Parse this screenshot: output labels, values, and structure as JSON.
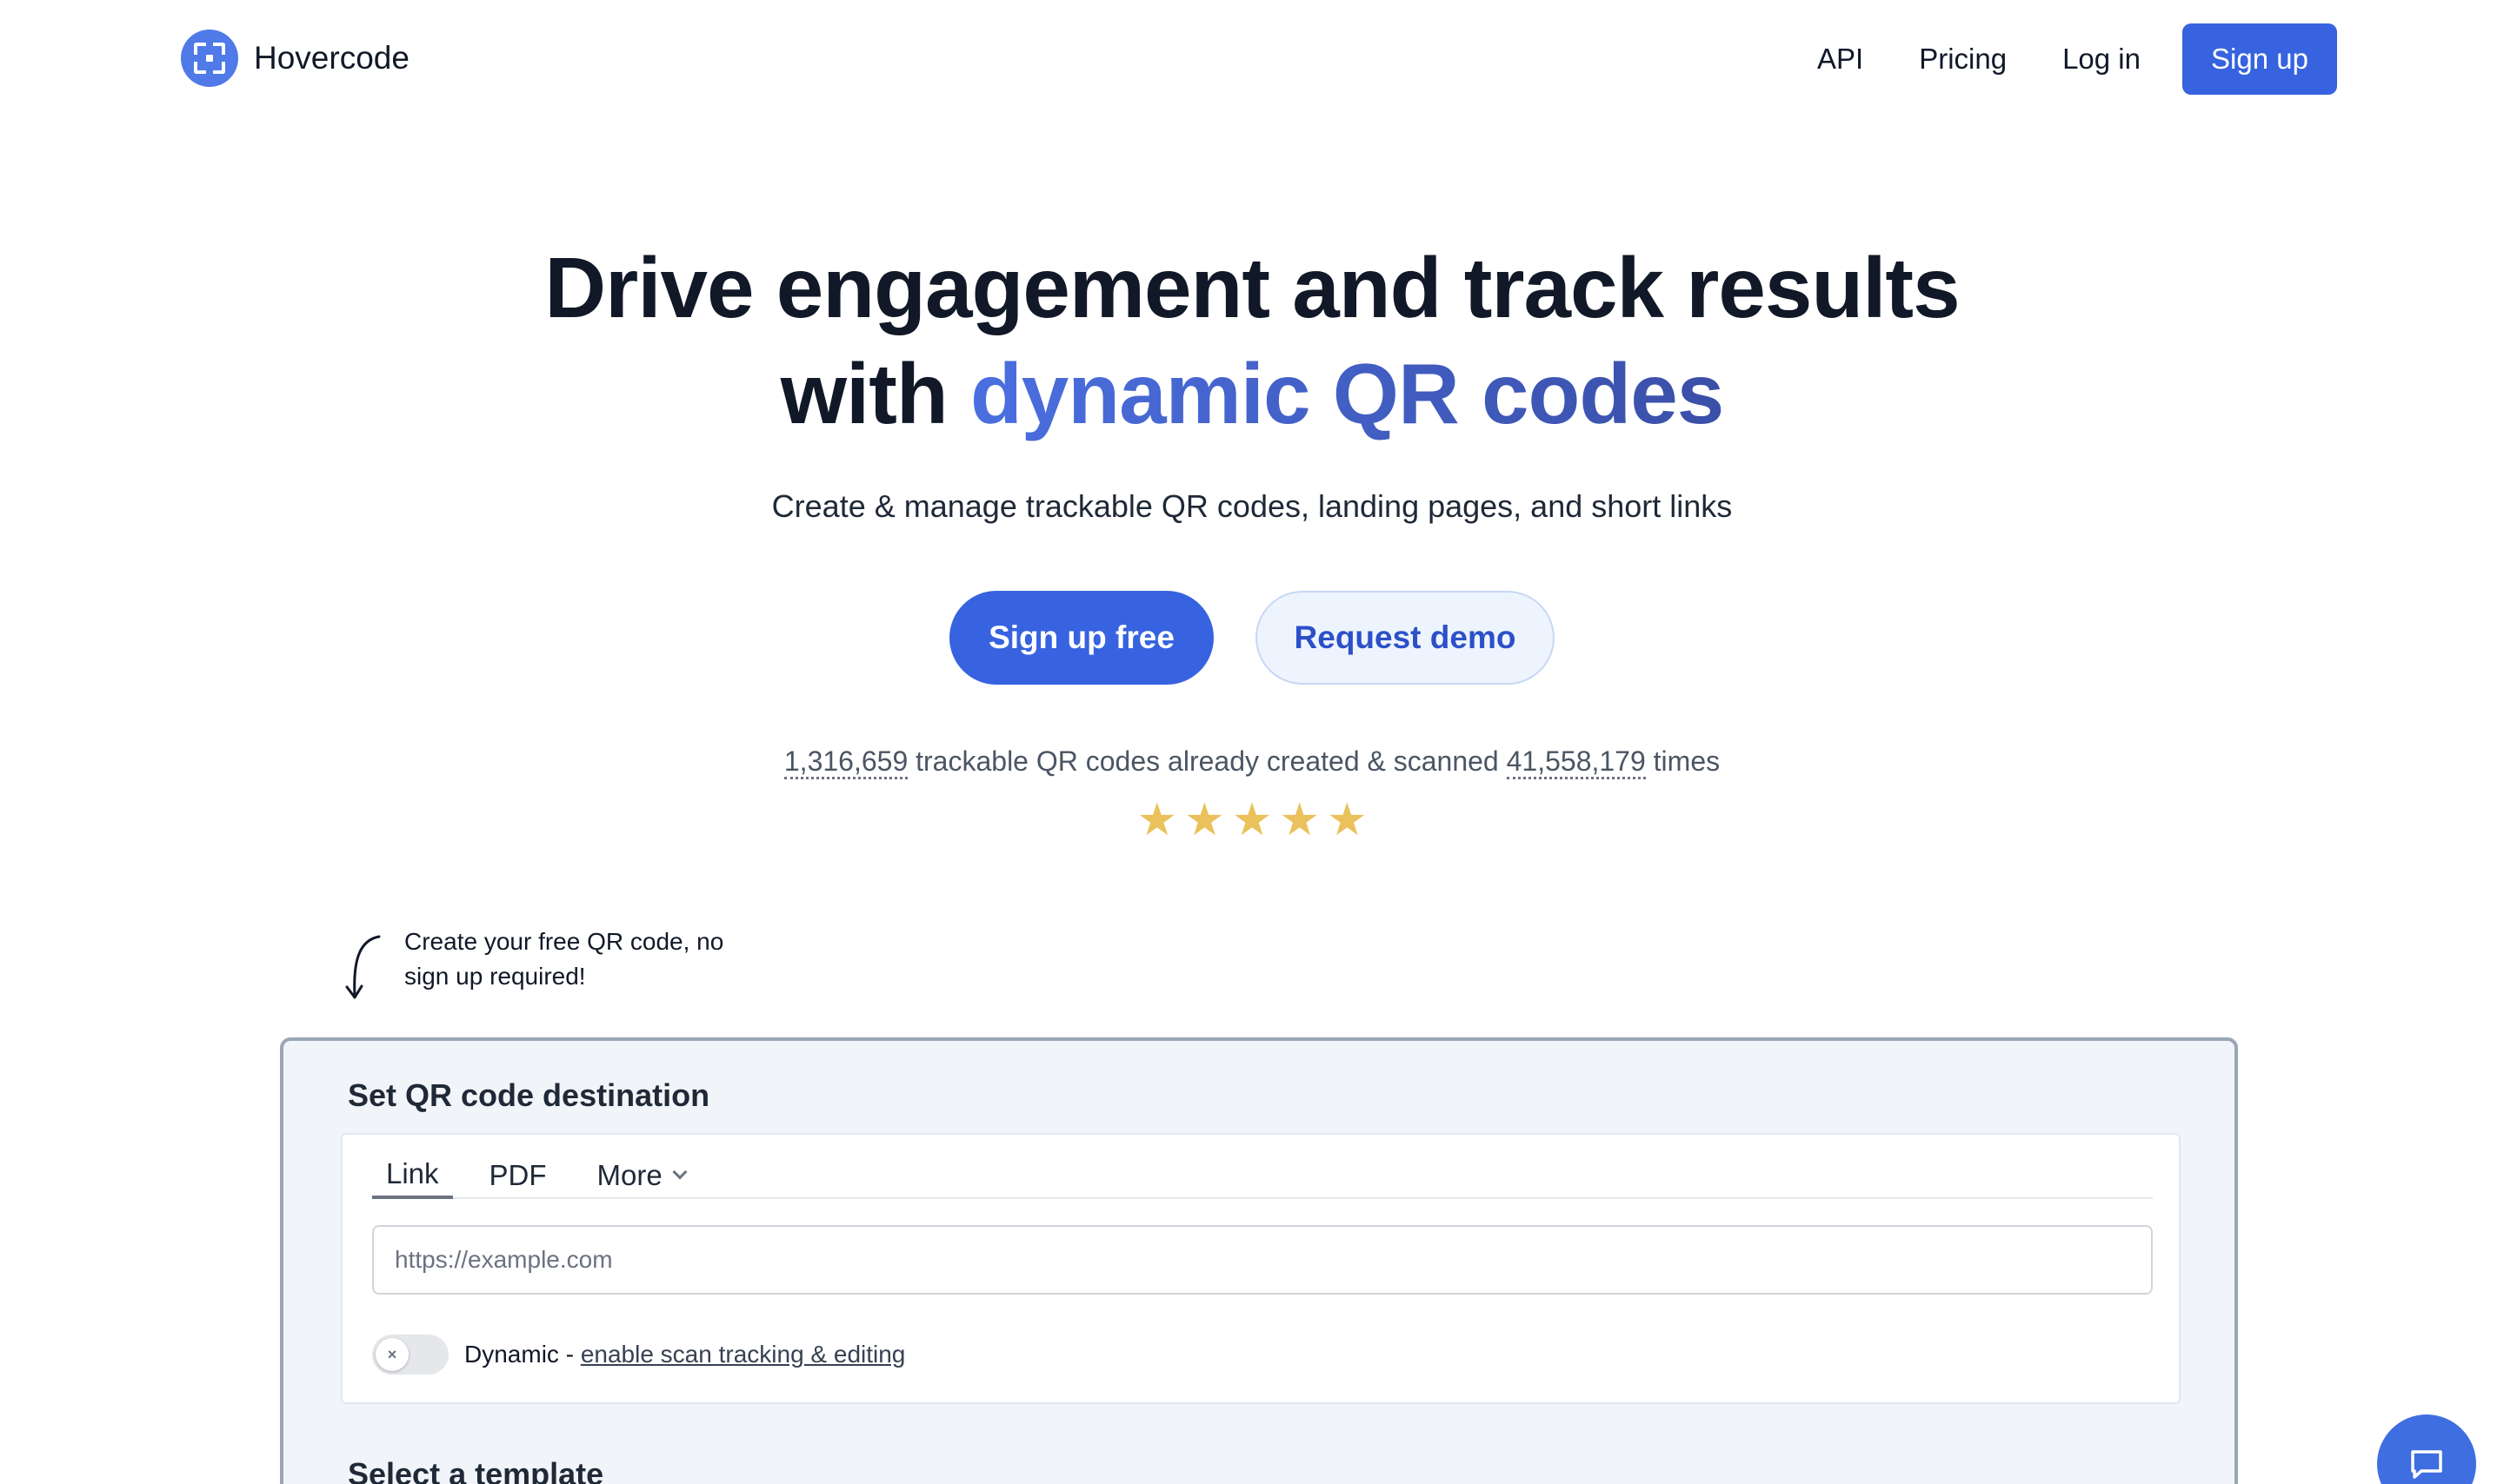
{
  "brand": {
    "name": "Hovercode",
    "color": "#4f7ae8",
    "icon": "qr-scan-icon"
  },
  "nav": {
    "api": "API",
    "pricing": "Pricing",
    "login": "Log in",
    "signup": "Sign up"
  },
  "hero": {
    "title_line1": "Drive engagement and track results",
    "title_prefix": "with ",
    "title_accent": "dynamic QR codes",
    "subtitle": "Create & manage trackable QR codes, landing pages, and short links",
    "primary_cta": "Sign up free",
    "secondary_cta": "Request demo"
  },
  "stats": {
    "codes_created": "1,316,659",
    "text_middle": " trackable QR codes already created & scanned ",
    "scans": "41,558,179",
    "text_end": " times",
    "rating_stars": 5,
    "star": "★"
  },
  "annotation": {
    "note": "Create your free QR code, no sign up required!"
  },
  "card": {
    "title": "Set QR code destination",
    "tabs": [
      "Link",
      "PDF",
      "More"
    ],
    "active_tab": "Link",
    "url_placeholder": "https://example.com",
    "url_value": "",
    "dynamic_toggle": {
      "on": false,
      "label": "Dynamic",
      "separator": " - ",
      "link": "enable scan tracking & editing",
      "knob_glyph": "×"
    },
    "template_title": "Select a template"
  },
  "colors": {
    "accent": "#3763e0",
    "star": "#eac15a",
    "card_bg": "#f1f5f9"
  }
}
